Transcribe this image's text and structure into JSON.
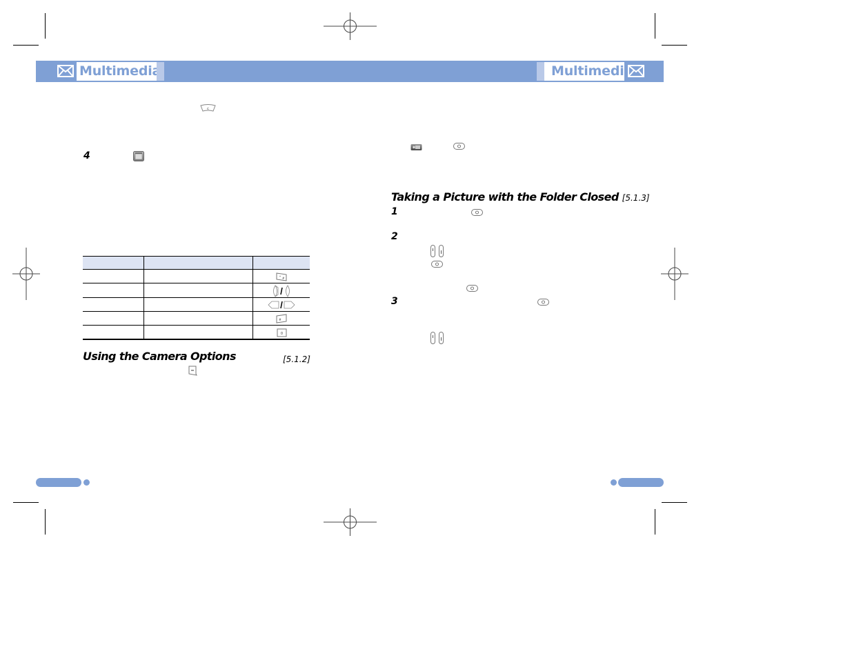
{
  "header": {
    "left_title": "Multimedia",
    "right_title": "Multimedia",
    "left_icon": "envelope-icon",
    "right_icon": "envelope-icon",
    "accent_color": "#7fa0d5",
    "strip_color": "#b9c9e8"
  },
  "left_page": {
    "keys": [
      {
        "name": "clear-key-icon"
      },
      {
        "name": "camera-menu-icon"
      }
    ],
    "step_4": "4",
    "table": {
      "header_color": "#dde4f3",
      "rows": [
        {
          "key_icon": "star-hash-key-icon"
        },
        {
          "key_icon": "volume-up-down-keys-icon",
          "separator": "/"
        },
        {
          "key_icon": "left-right-nav-keys-icon",
          "separator": "/"
        },
        {
          "key_icon": "pound-key-icon"
        },
        {
          "key_icon": "zero-key-icon"
        }
      ]
    },
    "section_heading": "Using the Camera Options",
    "section_ref": "[5.1.2]",
    "soft_key_icon": "left-soft-key-icon"
  },
  "right_page": {
    "top_icons": [
      "camera-mode-icon",
      "camera-key-icon"
    ],
    "section_heading": "Taking a Picture with the Folder Closed",
    "section_ref": "[5.1.3]",
    "steps": [
      "1",
      "2",
      "3"
    ],
    "icons": {
      "step1": "camera-key-icon",
      "step2_side_keys": "side-volume-keys-icon",
      "step2_camera": "camera-key-icon",
      "step2_camera_b": "camera-key-icon",
      "step3_camera": "camera-key-icon",
      "step3_side_keys": "side-volume-keys-icon"
    }
  }
}
